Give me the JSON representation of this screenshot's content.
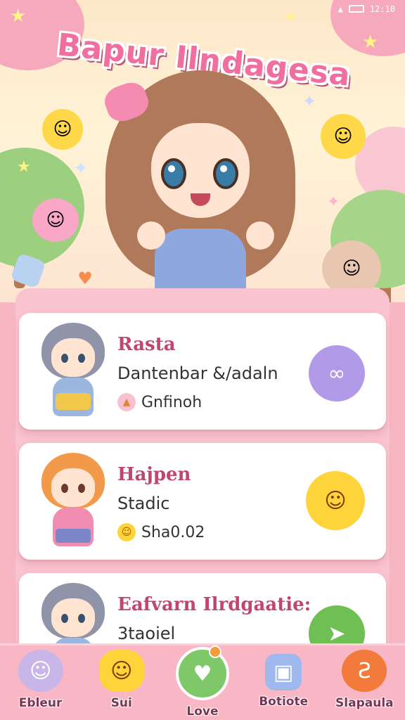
{
  "status_bar": {
    "time": "12:10"
  },
  "app": {
    "title": "Bapur Ilndagesa"
  },
  "cards": [
    {
      "name": "Rasta",
      "subtitle": "Dantenbar &/adaln",
      "tag": "Gnfinoh",
      "tag_icon": "triangle-icon",
      "action_icon": "chat-bubble-icon",
      "accent": "#b39ae8",
      "hair": "#8f94a8",
      "outfit": "#9bb7e0"
    },
    {
      "name": "Hajpen",
      "subtitle": "Stadic",
      "tag": "Sha0.02",
      "tag_icon": "smiley-icon",
      "action_icon": "happy-sun-icon",
      "accent": "#ffd43b",
      "hair": "#f29a4a",
      "outfit": "#f08db0"
    },
    {
      "name": "Eafvarn Ilrdgaatie:",
      "subtitle": "3taoiel",
      "tag": "",
      "tag_icon": "",
      "action_icon": "arrow-icon",
      "accent": "#6fbf55",
      "hair": "#8f94a8",
      "outfit": "#9bb7e0"
    }
  ],
  "nav": [
    {
      "label": "Ebleur",
      "icon": "ghost-icon",
      "active": false
    },
    {
      "label": "Sui",
      "icon": "chick-icon",
      "active": false
    },
    {
      "label": "Love",
      "icon": "heart-icon",
      "active": true
    },
    {
      "label": "Botiote",
      "icon": "bag-icon",
      "active": false
    },
    {
      "label": "Slapaula",
      "icon": "bell-icon",
      "active": false
    }
  ],
  "colors": {
    "primary_pink": "#f7b7c2",
    "title_pink": "#f06f9f",
    "card_title": "#c0466f",
    "nav_active": "#7ec86a"
  }
}
